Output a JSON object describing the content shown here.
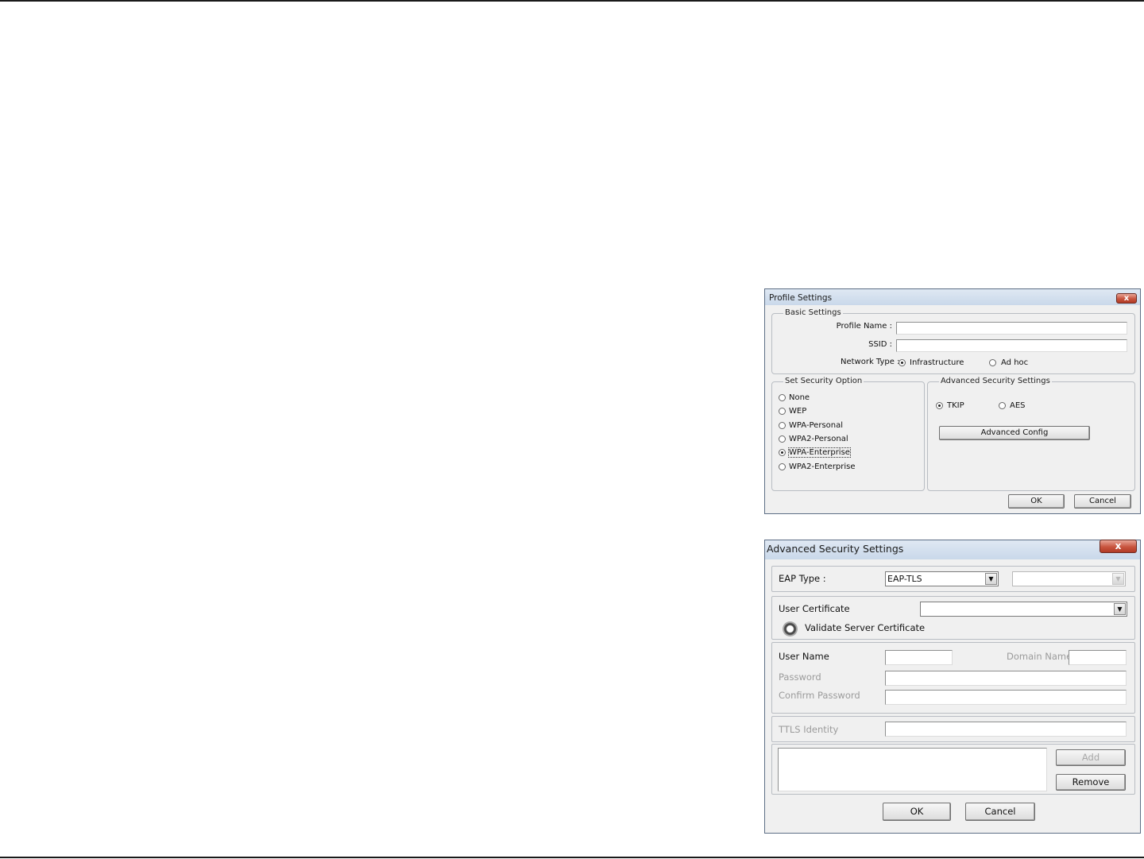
{
  "profile_settings": {
    "title": "Profile Settings",
    "close_glyph": "x",
    "basic_settings": {
      "legend": "Basic Settings",
      "profile_name_label": "Profile Name :",
      "profile_name_value": "",
      "ssid_label": "SSID :",
      "ssid_value": "",
      "network_type_label": "Network Type :",
      "network_types": [
        {
          "label": "Infrastructure",
          "selected": true
        },
        {
          "label": "Ad hoc",
          "selected": false
        }
      ]
    },
    "security_option": {
      "legend": "Set Security Option",
      "options": [
        {
          "label": "None",
          "selected": false
        },
        {
          "label": "WEP",
          "selected": false
        },
        {
          "label": "WPA-Personal",
          "selected": false
        },
        {
          "label": "WPA2-Personal",
          "selected": false
        },
        {
          "label": "WPA-Enterprise",
          "selected": true
        },
        {
          "label": "WPA2-Enterprise",
          "selected": false
        }
      ]
    },
    "advanced_security": {
      "legend": "Advanced Security Settings",
      "ciphers": [
        {
          "label": "TKIP",
          "selected": true
        },
        {
          "label": "AES",
          "selected": false
        }
      ],
      "advanced_config_label": "Advanced Config"
    },
    "ok_label": "OK",
    "cancel_label": "Cancel"
  },
  "advanced_security_settings": {
    "title": "Advanced Security Settings",
    "close_glyph": "x",
    "eap_type_label": "EAP Type :",
    "eap_type_value": "EAP-TLS",
    "eap_inner_value": "",
    "user_certificate_label": "User Certificate",
    "user_certificate_value": "",
    "validate_server_label": "Validate Server Certificate",
    "user_name_label": "User Name",
    "user_name_value": "",
    "domain_name_label": "Domain Name",
    "domain_name_value": "",
    "password_label": "Password",
    "confirm_password_label": "Confirm Password",
    "ttls_identity_label": "TTLS Identity",
    "add_label": "Add",
    "remove_label": "Remove",
    "ok_label": "OK",
    "cancel_label": "Cancel"
  }
}
